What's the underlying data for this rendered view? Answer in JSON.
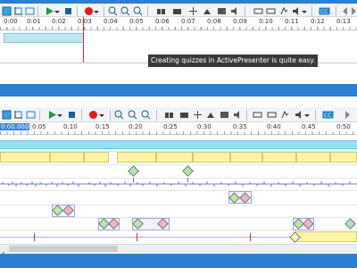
{
  "window": {
    "accent": "#2b7fd6",
    "top_strip_color": "#2b7fd6"
  },
  "top_timeline": {
    "time_labels": [
      "0:00",
      "0:01",
      "0:02",
      "0:03",
      "0:04",
      "0:05",
      "0:06",
      "0:07",
      "0:08",
      "0:09",
      "0:10",
      "0:11",
      "0:12",
      "0:13"
    ],
    "tooltip": "Creating quizzes in ActivePresenter is quite easy."
  },
  "bottom_timeline": {
    "playhead_time": "0:00.000",
    "time_labels": [
      "0:05",
      "0:10",
      "0:15",
      "0:20",
      "0:25",
      "0:30",
      "0:35",
      "0:40",
      "0:45",
      "0:50"
    ]
  },
  "icons": {
    "toolbar": [
      "select-icon",
      "crop-icon",
      "fit-icon",
      "play-icon",
      "play-dropdown-icon",
      "stop-icon",
      "record-icon",
      "record-dropdown-icon",
      "zoom-in-icon",
      "zoom-out-icon",
      "zoom-fit-icon",
      "split-icon",
      "join-icon",
      "insert-time-icon",
      "delete-time-icon",
      "freeze-icon",
      "mute-icon",
      "cut-icon",
      "copy-icon",
      "speed-icon",
      "volume-icon",
      "volume-dropdown-icon",
      "cc-icon",
      "prev-marker-icon",
      "next-marker-icon"
    ]
  },
  "colors": {
    "toolbar_bg": "#f2f4f7",
    "selection_bar": "#bfe6f2",
    "video_track": "#9fdcec",
    "text_track": "#fdf5a6",
    "playhead": "#cc3333",
    "scrollbar": "#c9ced6"
  }
}
